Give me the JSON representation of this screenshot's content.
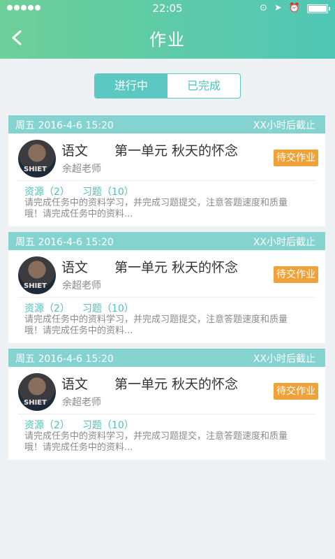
{
  "status_bar": {
    "time": "22:05",
    "signal_dots": 5
  },
  "nav": {
    "title": "作业",
    "back_icon": "chevron-left-icon"
  },
  "tabs": [
    {
      "label": "进行中",
      "active": true
    },
    {
      "label": "已完成",
      "active": false
    }
  ],
  "assignments": [
    {
      "date": "周五  2016-4-6  15:20",
      "deadline": "XX小时后截止",
      "subject": "语文",
      "title": "第一单元 秋天的怀念",
      "teacher": "余超老师",
      "status": "待交作业",
      "resources": "资源（2）",
      "exercises": "习题（10）",
      "description": "请完成任务中的资料学习，并完成习题提交，注意答题速度和质量哦！请完成任务中的资料..."
    },
    {
      "date": "周五  2016-4-6  15:20",
      "deadline": "XX小时后截止",
      "subject": "语文",
      "title": "第一单元 秋天的怀念",
      "teacher": "余超老师",
      "status": "待交作业",
      "resources": "资源（2）",
      "exercises": "习题（10）",
      "description": "请完成任务中的资料学习，并完成习题提交，注意答题速度和质量哦！请完成任务中的资料..."
    },
    {
      "date": "周五  2016-4-6  15:20",
      "deadline": "XX小时后截止",
      "subject": "语文",
      "title": "第一单元 秋天的怀念",
      "teacher": "余超老师",
      "status": "待交作业",
      "resources": "资源（2）",
      "exercises": "习题（10）",
      "description": "请完成任务中的资料学习，并完成习题提交，注意答题速度和质量哦！请完成任务中的资料..."
    }
  ],
  "colors": {
    "header_start": "#6ecf98",
    "header_end": "#4fc7b6",
    "accent": "#5bc8c2",
    "badge": "#f0a23a",
    "card_head": "#84d3d0"
  }
}
